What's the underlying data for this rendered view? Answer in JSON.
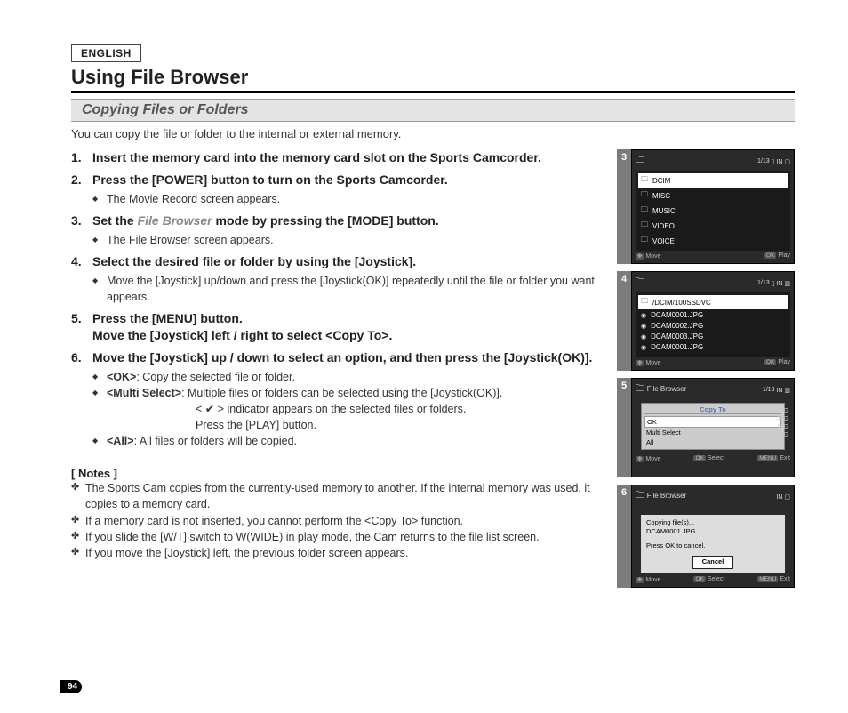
{
  "lang_tag": "ENGLISH",
  "title": "Using File Browser",
  "subtitle": "Copying Files or Folders",
  "intro": "You can copy the file or folder to the internal or external memory.",
  "steps": [
    {
      "head": "Insert the memory card into the memory card slot on the Sports Camcorder.",
      "subs": []
    },
    {
      "head": "Press the [POWER] button to turn on the Sports Camcorder.",
      "subs": [
        "The Movie Record screen appears."
      ]
    },
    {
      "head_pre": "Set the ",
      "head_muted": "File Browser",
      "head_post": " mode by pressing the [MODE] button.",
      "subs": [
        "The File Browser screen appears."
      ]
    },
    {
      "head": "Select the desired  file or folder by using the [Joystick].",
      "subs": [
        "Move the [Joystick] up/down and press the [Joystick(OK)] repeatedly until the file or folder you want appears."
      ]
    },
    {
      "head": "Press the [MENU] button.",
      "head_line2": "Move the [Joystick] left / right to select <Copy To>.",
      "subs": []
    },
    {
      "head": "Move the [Joystick] up / down to select an option, and then press the [Joystick(OK)].",
      "opts": [
        {
          "label": "<OK>",
          "text": ": Copy the selected file or folder."
        },
        {
          "label": "<Multi Select>",
          "text": ": Multiple files or folders can be selected using the [Joystick(OK)].",
          "extra1": "< ✔ > indicator appears on the selected files or folders.",
          "extra2": "Press the [PLAY] button."
        },
        {
          "label": "<All>",
          "text": ": All files or folders will be copied."
        }
      ]
    }
  ],
  "notes_head": "[ Notes ]",
  "notes": [
    "The Sports Cam copies from the currently-used memory to another. If the internal memory was used, it copies to a memory card.",
    "If a memory card is not inserted, you cannot perform the <Copy To> function.",
    "If you slide the [W/T] switch to W(WIDE) in play mode, the Cam returns to the file list screen.",
    "If you move the [Joystick] left, the previous folder screen appears."
  ],
  "page_number": "94",
  "screens": {
    "s3": {
      "num": "3",
      "counter": "1/13",
      "rows": [
        "DCIM",
        "MISC",
        "MUSIC",
        "VIDEO",
        "VOICE"
      ],
      "selected": 0,
      "bl": "Move",
      "br": "Play",
      "bl_tag": "⯀",
      "br_tag": "OK"
    },
    "s4": {
      "num": "4",
      "counter": "1/13",
      "path": "/DCIM/100SSDVC",
      "rows": [
        "DCAM0001.JPG",
        "DCAM0002.JPG",
        "DCAM0003.JPG",
        "DCAM0001.JPG"
      ],
      "selected": 0,
      "bl": "Move",
      "br": "Play"
    },
    "s5": {
      "num": "5",
      "title": "File Browser",
      "counter": "1/13",
      "menu_title": "Copy To",
      "menu_items": [
        "OK",
        "Multi Select",
        "All"
      ],
      "side": [
        "JPG",
        "JPG",
        "JPG",
        "JPG"
      ],
      "bl": "Move",
      "bm": "Select",
      "br": "Exit",
      "bm_tag": "OK",
      "br_tag": "MENU"
    },
    "s6": {
      "num": "6",
      "title": "File Browser",
      "msg1": "Copying file(s)...",
      "msg2": "DCAM0001.JPG",
      "msg3": "Press OK to cancel.",
      "cancel": "Cancel",
      "bl": "Move",
      "bm": "Select",
      "br": "Exit"
    }
  }
}
